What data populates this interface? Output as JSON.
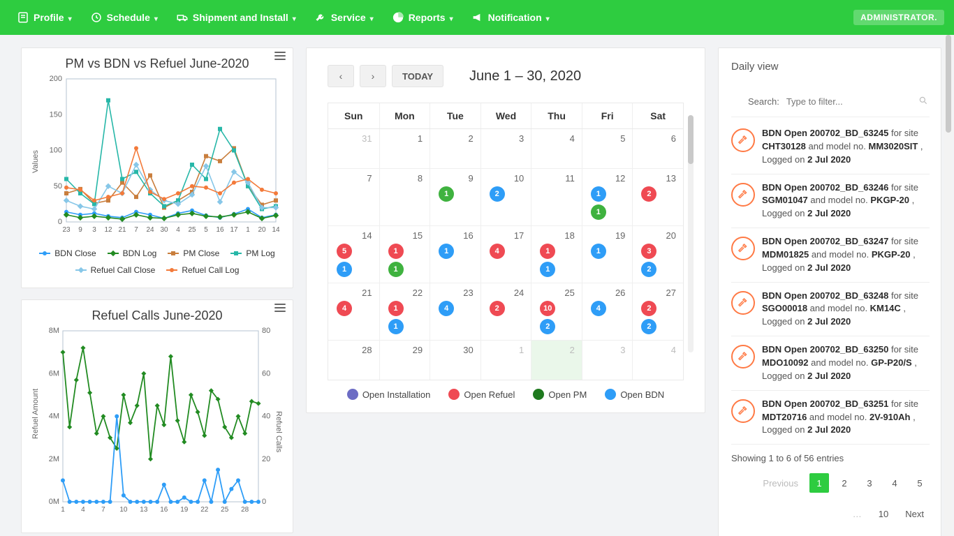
{
  "nav": {
    "profile": "Profile",
    "schedule": "Schedule",
    "shipment": "Shipment and Install",
    "service": "Service",
    "reports": "Reports",
    "notification": "Notification",
    "admin": "ADMINISTRATOR."
  },
  "chart1": {
    "title": "PM vs BDN vs Refuel June-2020",
    "yTicks": [
      "0",
      "50",
      "100",
      "150",
      "200"
    ],
    "xTicks": [
      "23",
      "9",
      "3",
      "12",
      "21",
      "7",
      "24",
      "30",
      "4",
      "25",
      "5",
      "16",
      "17",
      "1",
      "20",
      "14"
    ],
    "yAxisLabel": "Values",
    "legend": {
      "bdnClose": "BDN Close",
      "bdnLog": "BDN Log",
      "pmClose": "PM Close",
      "pmLog": "PM Log",
      "refuelClose": "Refuel Call Close",
      "refuelLog": "Refuel Call Log"
    }
  },
  "chart2": {
    "title": "Refuel Calls June-2020",
    "leftTicks": [
      "0M",
      "2M",
      "4M",
      "6M",
      "8M"
    ],
    "rightTicks": [
      "0",
      "20",
      "40",
      "60",
      "80"
    ],
    "xTicks": [
      "1",
      "4",
      "7",
      "10",
      "13",
      "16",
      "19",
      "22",
      "25",
      "28"
    ],
    "leftAxisLabel": "Refuel Amount",
    "rightAxisLabel": "Refuel Calls"
  },
  "calendar": {
    "today": "TODAY",
    "range": "June 1 – 30, 2020",
    "days": [
      "Sun",
      "Mon",
      "Tue",
      "Wed",
      "Thu",
      "Fri",
      "Sat"
    ],
    "legend": {
      "install": "Open Installation",
      "refuel": "Open Refuel",
      "pm": "Open PM",
      "bdn": "Open BDN"
    },
    "weeks": [
      [
        {
          "d": "31",
          "muted": true
        },
        {
          "d": "1"
        },
        {
          "d": "2"
        },
        {
          "d": "3"
        },
        {
          "d": "4"
        },
        {
          "d": "5"
        },
        {
          "d": "6"
        }
      ],
      [
        {
          "d": "7"
        },
        {
          "d": "8"
        },
        {
          "d": "9",
          "ev": [
            {
              "c": "green",
              "n": "1"
            }
          ]
        },
        {
          "d": "10",
          "ev": [
            {
              "c": "blue",
              "n": "2"
            }
          ]
        },
        {
          "d": "11"
        },
        {
          "d": "12",
          "ev": [
            {
              "c": "blue",
              "n": "1"
            },
            {
              "c": "green",
              "n": "1"
            }
          ]
        },
        {
          "d": "13",
          "ev": [
            {
              "c": "red",
              "n": "2"
            }
          ]
        }
      ],
      [
        {
          "d": "14",
          "ev": [
            {
              "c": "red",
              "n": "5"
            },
            {
              "c": "blue",
              "n": "1"
            }
          ]
        },
        {
          "d": "15",
          "ev": [
            {
              "c": "red",
              "n": "1"
            },
            {
              "c": "green",
              "n": "1"
            }
          ]
        },
        {
          "d": "16",
          "ev": [
            {
              "c": "blue",
              "n": "1"
            }
          ]
        },
        {
          "d": "17",
          "ev": [
            {
              "c": "red",
              "n": "4"
            }
          ]
        },
        {
          "d": "18",
          "ev": [
            {
              "c": "red",
              "n": "1"
            },
            {
              "c": "blue",
              "n": "1"
            }
          ]
        },
        {
          "d": "19",
          "ev": [
            {
              "c": "blue",
              "n": "1"
            }
          ]
        },
        {
          "d": "20",
          "ev": [
            {
              "c": "red",
              "n": "3"
            },
            {
              "c": "blue",
              "n": "2"
            }
          ]
        }
      ],
      [
        {
          "d": "21",
          "ev": [
            {
              "c": "red",
              "n": "4"
            }
          ]
        },
        {
          "d": "22",
          "ev": [
            {
              "c": "red",
              "n": "1"
            },
            {
              "c": "blue",
              "n": "1"
            }
          ]
        },
        {
          "d": "23",
          "ev": [
            {
              "c": "blue",
              "n": "4"
            }
          ]
        },
        {
          "d": "24",
          "ev": [
            {
              "c": "red",
              "n": "2"
            }
          ]
        },
        {
          "d": "25",
          "ev": [
            {
              "c": "red",
              "n": "10"
            },
            {
              "c": "blue",
              "n": "2"
            }
          ]
        },
        {
          "d": "26",
          "ev": [
            {
              "c": "blue",
              "n": "4"
            }
          ]
        },
        {
          "d": "27",
          "ev": [
            {
              "c": "red",
              "n": "2"
            },
            {
              "c": "blue",
              "n": "2"
            }
          ]
        }
      ],
      [
        {
          "d": "28"
        },
        {
          "d": "29"
        },
        {
          "d": "30"
        },
        {
          "d": "1",
          "muted": true
        },
        {
          "d": "2",
          "muted": true,
          "hl": true
        },
        {
          "d": "3",
          "muted": true
        },
        {
          "d": "4",
          "muted": true
        }
      ]
    ]
  },
  "daily": {
    "title": "Daily view",
    "searchLabel": "Search:",
    "searchPlaceholder": "Type to filter...",
    "showing": "Showing 1 to 6 of 56 entries",
    "prev": "Previous",
    "next": "Next",
    "ellipsis": "…",
    "tenLabel": "10",
    "pages": [
      "1",
      "2",
      "3",
      "4",
      "5"
    ],
    "logs": [
      {
        "id": "200702_BD_63245",
        "site": "CHT30128",
        "model": "MM3020SIT",
        "date": "2 Jul 2020"
      },
      {
        "id": "200702_BD_63246",
        "site": "SGM01047",
        "model": "PKGP-20",
        "date": "2 Jul 2020"
      },
      {
        "id": "200702_BD_63247",
        "site": "MDM01825",
        "model": "PKGP-20",
        "date": "2 Jul 2020"
      },
      {
        "id": "200702_BD_63248",
        "site": "SGO00018",
        "model": "KM14C",
        "date": "2 Jul 2020"
      },
      {
        "id": "200702_BD_63250",
        "site": "MDO10092",
        "model": "GP-P20/S",
        "date": "2 Jul 2020"
      },
      {
        "id": "200702_BD_63251",
        "site": "MDT20716",
        "model": "2V-910Ah",
        "date": "2 Jul 2020"
      }
    ],
    "prefix": "BDN Open",
    "forSite": "for site",
    "andModel": "and model no.",
    "loggedOn": ", Logged on"
  },
  "colors": {
    "primary": "#2ecc40",
    "blue": "#2e9df7",
    "red": "#ef4a53",
    "green": "#3fb23f",
    "dgreen": "#1f7a1f",
    "purple": "#6c6cc4",
    "orange": "#ff7a45",
    "teal": "#27b7a8",
    "darkgreen": "#228b22",
    "brown": "#c97e3d",
    "lightblue": "#87c7e8",
    "orangeLine": "#f37a3a"
  },
  "chart_data": [
    {
      "type": "line",
      "title": "PM vs BDN vs Refuel June-2020",
      "ylabel": "Values",
      "ylim": [
        0,
        200
      ],
      "x": [
        "23",
        "9",
        "3",
        "12",
        "21",
        "7",
        "24",
        "30",
        "4",
        "25",
        "5",
        "16",
        "17",
        "1",
        "20",
        "14"
      ],
      "series": [
        {
          "name": "BDN Close",
          "values": [
            14,
            10,
            12,
            8,
            6,
            14,
            10,
            5,
            12,
            16,
            9,
            6,
            11,
            18,
            6,
            10
          ]
        },
        {
          "name": "BDN Log",
          "values": [
            10,
            6,
            8,
            6,
            4,
            10,
            6,
            5,
            10,
            12,
            8,
            7,
            10,
            14,
            5,
            9
          ]
        },
        {
          "name": "PM Close",
          "values": [
            40,
            46,
            26,
            30,
            55,
            35,
            65,
            20,
            30,
            42,
            92,
            85,
            103,
            50,
            24,
            30
          ]
        },
        {
          "name": "PM Log",
          "values": [
            60,
            40,
            25,
            170,
            60,
            70,
            40,
            22,
            30,
            80,
            60,
            130,
            100,
            50,
            18,
            22
          ]
        },
        {
          "name": "Refuel Call Close",
          "values": [
            30,
            22,
            18,
            50,
            40,
            80,
            45,
            30,
            25,
            38,
            78,
            28,
            70,
            55,
            20,
            20
          ]
        },
        {
          "name": "Refuel Call Log",
          "values": [
            48,
            45,
            30,
            35,
            40,
            103,
            42,
            32,
            40,
            50,
            48,
            40,
            55,
            60,
            45,
            40
          ]
        }
      ]
    },
    {
      "type": "line",
      "title": "Refuel Calls June-2020",
      "xlabel": "",
      "x": [
        1,
        2,
        3,
        4,
        5,
        6,
        7,
        8,
        9,
        10,
        11,
        12,
        13,
        14,
        15,
        16,
        17,
        18,
        19,
        20,
        21,
        22,
        23,
        24,
        25,
        26,
        27,
        28,
        29,
        30
      ],
      "series": [
        {
          "name": "Refuel Amount",
          "axis": "left",
          "ylabel": "Refuel Amount",
          "ylim": [
            0,
            8000000
          ],
          "values": [
            7000000,
            3500000,
            5700000,
            7200000,
            5100000,
            3200000,
            4000000,
            3000000,
            2500000,
            5000000,
            3700000,
            4500000,
            6000000,
            2000000,
            4500000,
            3600000,
            6800000,
            3800000,
            2800000,
            5000000,
            4200000,
            3100000,
            5200000,
            4800000,
            3500000,
            3000000,
            4000000,
            3200000,
            4700000,
            4600000
          ]
        },
        {
          "name": "Refuel Calls",
          "axis": "right",
          "ylabel": "Refuel Calls",
          "ylim": [
            0,
            80
          ],
          "values": [
            10,
            0,
            0,
            0,
            0,
            0,
            0,
            0,
            40,
            3,
            0,
            0,
            0,
            0,
            0,
            8,
            0,
            0,
            2,
            0,
            0,
            10,
            0,
            15,
            0,
            6,
            10,
            0,
            0,
            0
          ]
        }
      ]
    }
  ]
}
